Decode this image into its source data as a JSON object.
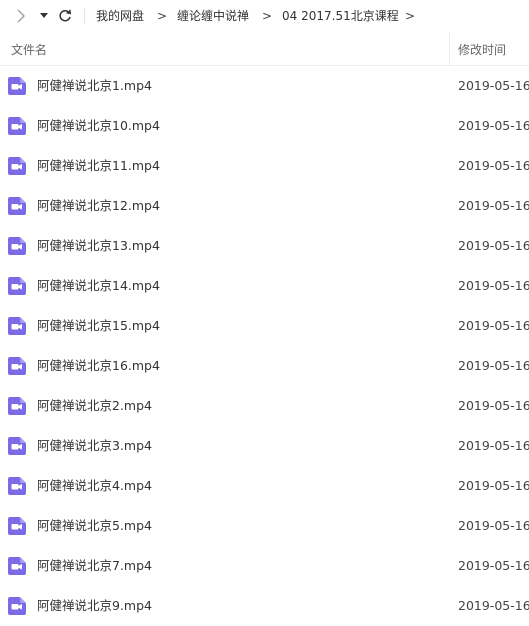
{
  "toolbar": {
    "icons": [
      "chevron-right-icon",
      "caret-down-icon",
      "refresh-icon"
    ],
    "breadcrumb": [
      "我的网盘",
      "缠论缠中说禅",
      "04 2017.51北京课程"
    ],
    "separator": ">"
  },
  "header": {
    "name_label": "文件名",
    "date_label": "修改时间"
  },
  "colors": {
    "video_icon": "#7b6ce6",
    "text": "#333333",
    "muted": "#666666"
  },
  "files": [
    {
      "name": "阿健禅说北京1.mp4",
      "date": "2019-05-16",
      "icon": "video-file-icon"
    },
    {
      "name": "阿健禅说北京10.mp4",
      "date": "2019-05-16",
      "icon": "video-file-icon"
    },
    {
      "name": "阿健禅说北京11.mp4",
      "date": "2019-05-16",
      "icon": "video-file-icon"
    },
    {
      "name": "阿健禅说北京12.mp4",
      "date": "2019-05-16",
      "icon": "video-file-icon"
    },
    {
      "name": "阿健禅说北京13.mp4",
      "date": "2019-05-16",
      "icon": "video-file-icon"
    },
    {
      "name": "阿健禅说北京14.mp4",
      "date": "2019-05-16",
      "icon": "video-file-icon"
    },
    {
      "name": "阿健禅说北京15.mp4",
      "date": "2019-05-16",
      "icon": "video-file-icon"
    },
    {
      "name": "阿健禅说北京16.mp4",
      "date": "2019-05-16",
      "icon": "video-file-icon"
    },
    {
      "name": "阿健禅说北京2.mp4",
      "date": "2019-05-16",
      "icon": "video-file-icon"
    },
    {
      "name": "阿健禅说北京3.mp4",
      "date": "2019-05-16",
      "icon": "video-file-icon"
    },
    {
      "name": "阿健禅说北京4.mp4",
      "date": "2019-05-16",
      "icon": "video-file-icon"
    },
    {
      "name": "阿健禅说北京5.mp4",
      "date": "2019-05-16",
      "icon": "video-file-icon"
    },
    {
      "name": "阿健禅说北京7.mp4",
      "date": "2019-05-16",
      "icon": "video-file-icon"
    },
    {
      "name": "阿健禅说北京9.mp4",
      "date": "2019-05-16",
      "icon": "video-file-icon"
    }
  ]
}
